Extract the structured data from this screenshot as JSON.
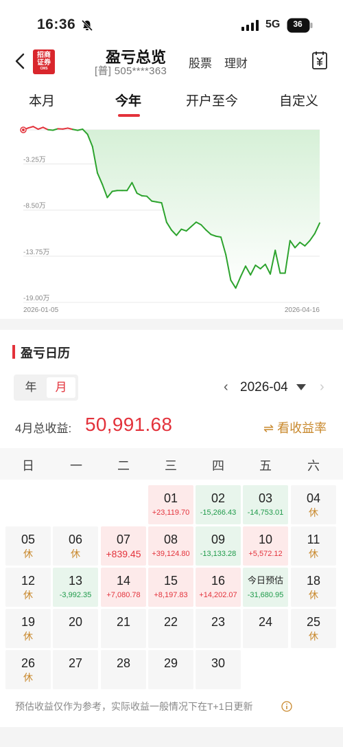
{
  "status": {
    "time": "16:36",
    "network": "5G",
    "battery": "36"
  },
  "header": {
    "title": "盈亏总览",
    "account": "[普] 505****363",
    "nav": [
      "股票",
      "理财"
    ],
    "logo_text": [
      "招商",
      "证券"
    ],
    "logo_sub": "CMS"
  },
  "tabs": [
    "本月",
    "今年",
    "开户至今",
    "自定义"
  ],
  "chart_data": {
    "type": "area",
    "x_start": "2026-01-05",
    "x_end": "2026-04-16",
    "y_ticks": [
      "-3.25万",
      "-8.50万",
      "-13.75万",
      "-19.00万"
    ],
    "y_values": [
      -32500,
      -85000,
      -137500,
      -190000
    ],
    "series": [
      {
        "values": [
          0,
          2200,
          3800,
          800,
          2900,
          200,
          -400,
          1300,
          1000,
          2000,
          600,
          -500,
          800,
          -5000,
          -19000,
          -49000,
          -62000,
          -77000,
          -70000,
          -69000,
          -69000,
          -69000,
          -60000,
          -72000,
          -75000,
          -75500,
          -81000,
          -82000,
          -83000,
          -105000,
          -114000,
          -120000,
          -113000,
          -115000,
          -110000,
          -105000,
          -108000,
          -114000,
          -119000,
          -121000,
          -122000,
          -142000,
          -171000,
          -180000,
          -167000,
          -155000,
          -165000,
          -154000,
          -158000,
          -153000,
          -164000,
          -137000,
          -163000,
          -163000,
          -126000,
          -134000,
          -128000,
          -132000,
          -126000,
          -118000,
          -106000
        ]
      }
    ],
    "colors": {
      "up": "#e3323b",
      "down": "#2ca32d",
      "fill_down": "#d6f0d7"
    }
  },
  "calendar": {
    "title": "盈亏日历",
    "toggle": [
      "年",
      "月"
    ],
    "month": "2026-04",
    "total_label": "4月总收益:",
    "total_value": "50,991.68",
    "rate_link": "⇌ 看收益率",
    "weekdays": [
      "日",
      "一",
      "二",
      "三",
      "四",
      "五",
      "六"
    ],
    "days": [
      {
        "day": "01",
        "value": "+23,119.70",
        "kind": "red"
      },
      {
        "day": "02",
        "value": "-15,266.43",
        "kind": "green"
      },
      {
        "day": "03",
        "value": "-14,753.01",
        "kind": "green"
      },
      {
        "day": "04",
        "value": "休",
        "kind": "rest"
      },
      {
        "day": "05",
        "value": "休",
        "kind": "rest"
      },
      {
        "day": "06",
        "value": "休",
        "kind": "rest"
      },
      {
        "day": "07",
        "value": "+839.45",
        "kind": "red"
      },
      {
        "day": "08",
        "value": "+39,124.80",
        "kind": "red"
      },
      {
        "day": "09",
        "value": "-13,133.28",
        "kind": "green"
      },
      {
        "day": "10",
        "value": "+5,572.12",
        "kind": "red"
      },
      {
        "day": "11",
        "value": "休",
        "kind": "rest"
      },
      {
        "day": "12",
        "value": "休",
        "kind": "rest"
      },
      {
        "day": "13",
        "value": "-3,992.35",
        "kind": "green"
      },
      {
        "day": "14",
        "value": "+7,080.78",
        "kind": "red"
      },
      {
        "day": "15",
        "value": "+8,197.83",
        "kind": "red"
      },
      {
        "day": "16",
        "value": "+14,202.07",
        "kind": "red"
      },
      {
        "day": "今日预估",
        "value": "-31,680.95",
        "kind": "green"
      },
      {
        "day": "18",
        "value": "休",
        "kind": "rest"
      },
      {
        "day": "19",
        "value": "休",
        "kind": "rest"
      },
      {
        "day": "20",
        "value": "",
        "kind": "plain"
      },
      {
        "day": "21",
        "value": "",
        "kind": "plain"
      },
      {
        "day": "22",
        "value": "",
        "kind": "plain"
      },
      {
        "day": "23",
        "value": "",
        "kind": "plain"
      },
      {
        "day": "24",
        "value": "",
        "kind": "plain"
      },
      {
        "day": "25",
        "value": "休",
        "kind": "rest"
      },
      {
        "day": "26",
        "value": "休",
        "kind": "rest"
      },
      {
        "day": "27",
        "value": "",
        "kind": "plain"
      },
      {
        "day": "28",
        "value": "",
        "kind": "plain"
      },
      {
        "day": "29",
        "value": "",
        "kind": "plain"
      },
      {
        "day": "30",
        "value": "",
        "kind": "plain"
      }
    ],
    "footnote": "预估收益仅作为参考，实际收益一般情况下在T+1日更新"
  }
}
